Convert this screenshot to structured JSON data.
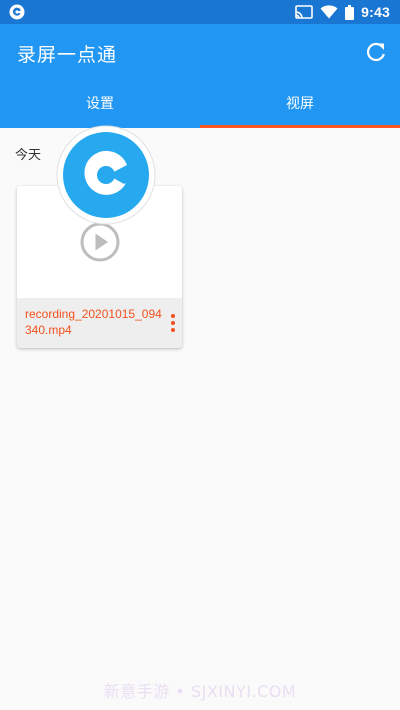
{
  "status_bar": {
    "time": "9:43",
    "icons": [
      "app-notification-icon",
      "cast-icon",
      "wifi-icon",
      "battery-icon"
    ]
  },
  "app_bar": {
    "title": "录屏一点通",
    "refresh_icon": "refresh-icon"
  },
  "tabs": [
    {
      "label": "设置",
      "active": false
    },
    {
      "label": "视屏",
      "active": true
    }
  ],
  "main": {
    "section_label": "今天",
    "recordings": [
      {
        "file_name": "recording_20201015_094340.mp4",
        "icon": "play-icon"
      }
    ]
  },
  "floating_button": {
    "icon": "app-logo-icon"
  },
  "watermark": "新意手游 • SJXINYI.COM",
  "colors": {
    "status_bar": "#1976d2",
    "app_bar": "#2196f3",
    "tab_indicator": "#ff5722",
    "file_name": "#f4511e",
    "background": "#fafafa"
  }
}
